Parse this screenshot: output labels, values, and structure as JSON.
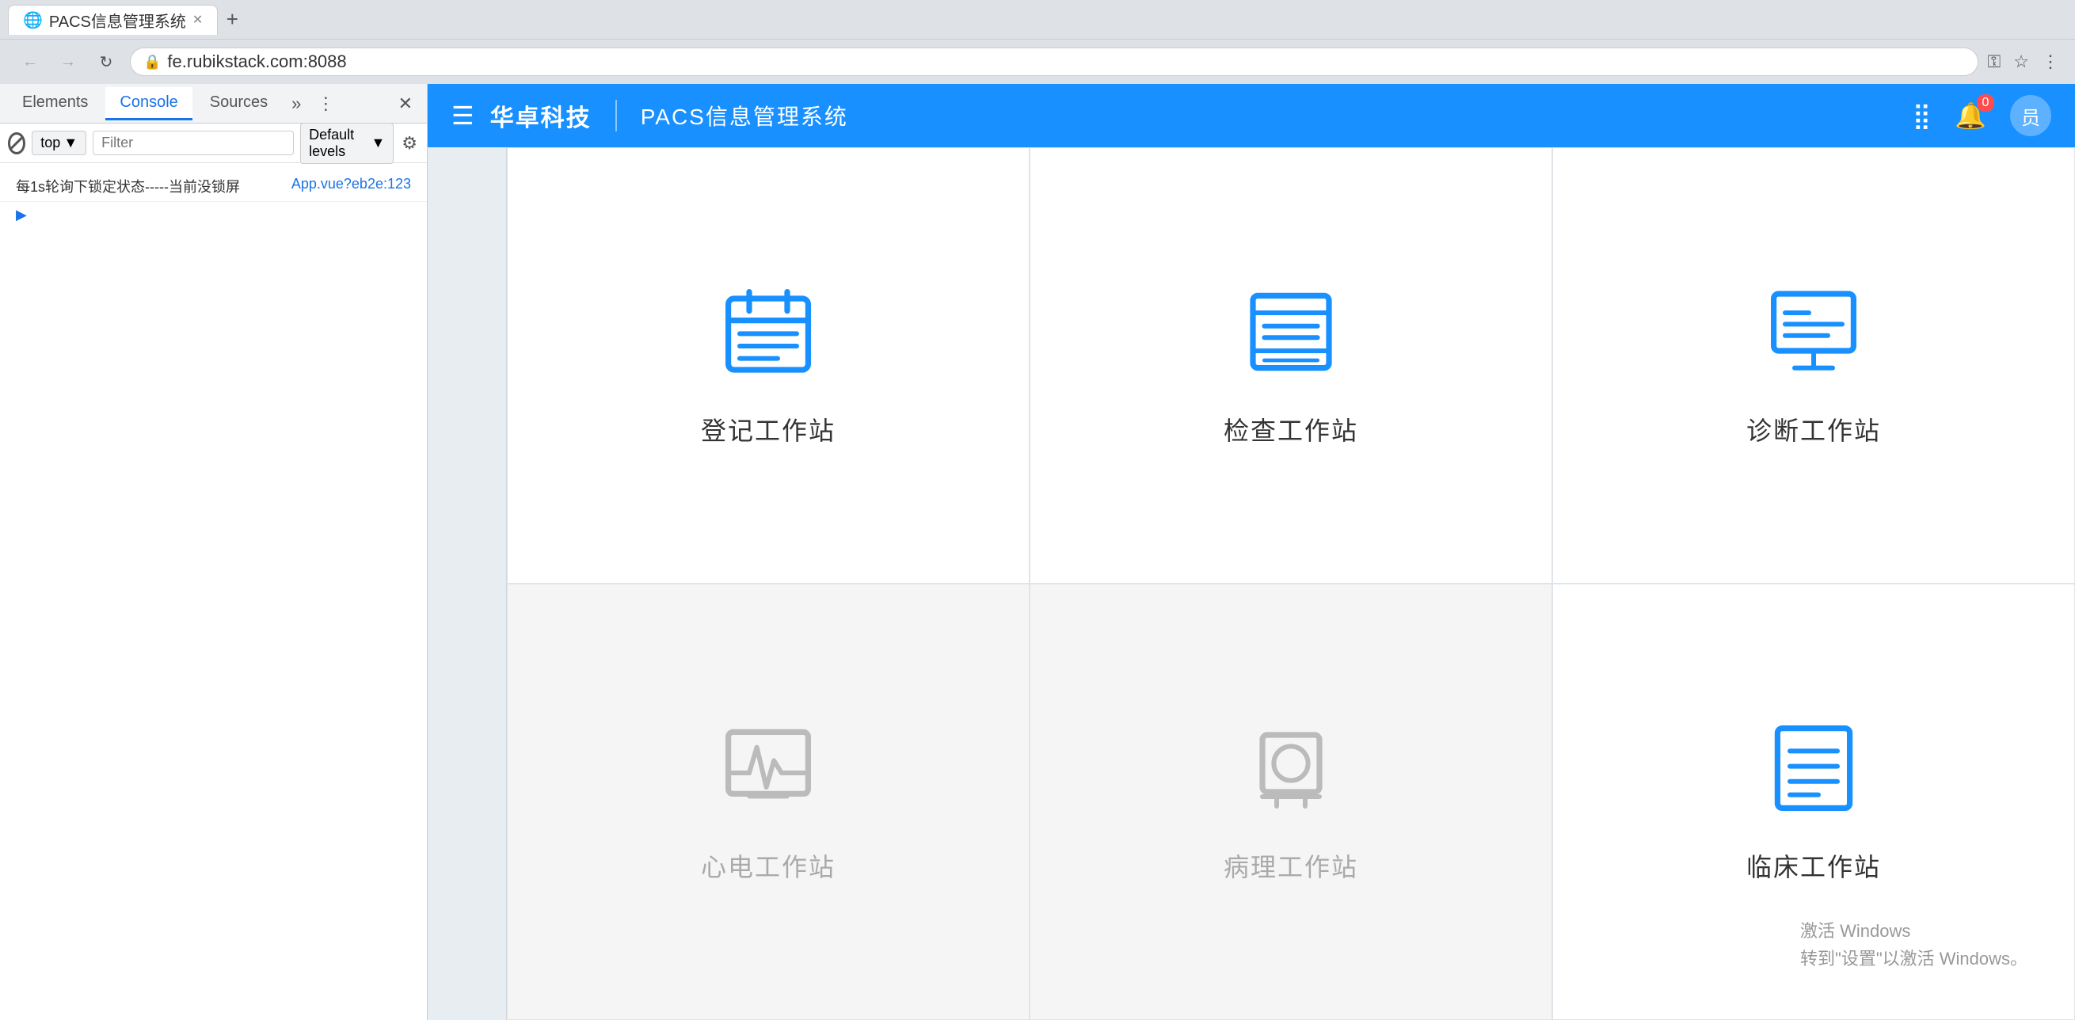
{
  "browser": {
    "url": "fe.rubikstack.com:8088",
    "back_btn": "←",
    "forward_btn": "→",
    "reload_btn": "↻",
    "nav_disabled": [
      "back",
      "forward"
    ],
    "lock_icon": "🔒",
    "key_icon": "⚿",
    "star_icon": "☆",
    "more_icon": "⋮"
  },
  "devtools": {
    "tabs": [
      {
        "label": "Elements",
        "active": false
      },
      {
        "label": "Console",
        "active": true
      },
      {
        "label": "Sources",
        "active": false
      }
    ],
    "more_icon": "»",
    "options_icon": "⋮",
    "close_icon": "✕",
    "console": {
      "context": "top",
      "filter_placeholder": "Filter",
      "level": "Default levels",
      "settings_icon": "⚙",
      "messages": [
        {
          "text": "每1s轮询下锁定状态-----当前没锁屏",
          "source": "App.vue?eb2e:123",
          "has_arrow": false
        }
      ],
      "expand_arrow": "▶"
    }
  },
  "app": {
    "header": {
      "menu_icon": "☰",
      "brand": "华卓科技",
      "divider": "|",
      "system_name": "PACS信息管理系统",
      "apps_icon": "⣿",
      "notif_icon": "🔔",
      "notif_badge": "0",
      "user_label": "员"
    },
    "workstations": [
      {
        "id": "dengji",
        "label": "登记工作站",
        "enabled": true,
        "icon_type": "calendar"
      },
      {
        "id": "jiancha",
        "label": "检查工作站",
        "enabled": true,
        "icon_type": "book"
      },
      {
        "id": "zhenduan",
        "label": "诊断工作站",
        "enabled": true,
        "icon_type": "monitor"
      },
      {
        "id": "xindian",
        "label": "心电工作站",
        "enabled": false,
        "icon_type": "ecg"
      },
      {
        "id": "bingli",
        "label": "病理工作站",
        "enabled": false,
        "icon_type": "microscope"
      },
      {
        "id": "linchuang",
        "label": "临床工作站",
        "enabled": true,
        "icon_type": "document"
      }
    ],
    "windows_activate": {
      "line1": "激活 Windows",
      "line2": "转到\"设置\"以激活 Windows。"
    }
  }
}
